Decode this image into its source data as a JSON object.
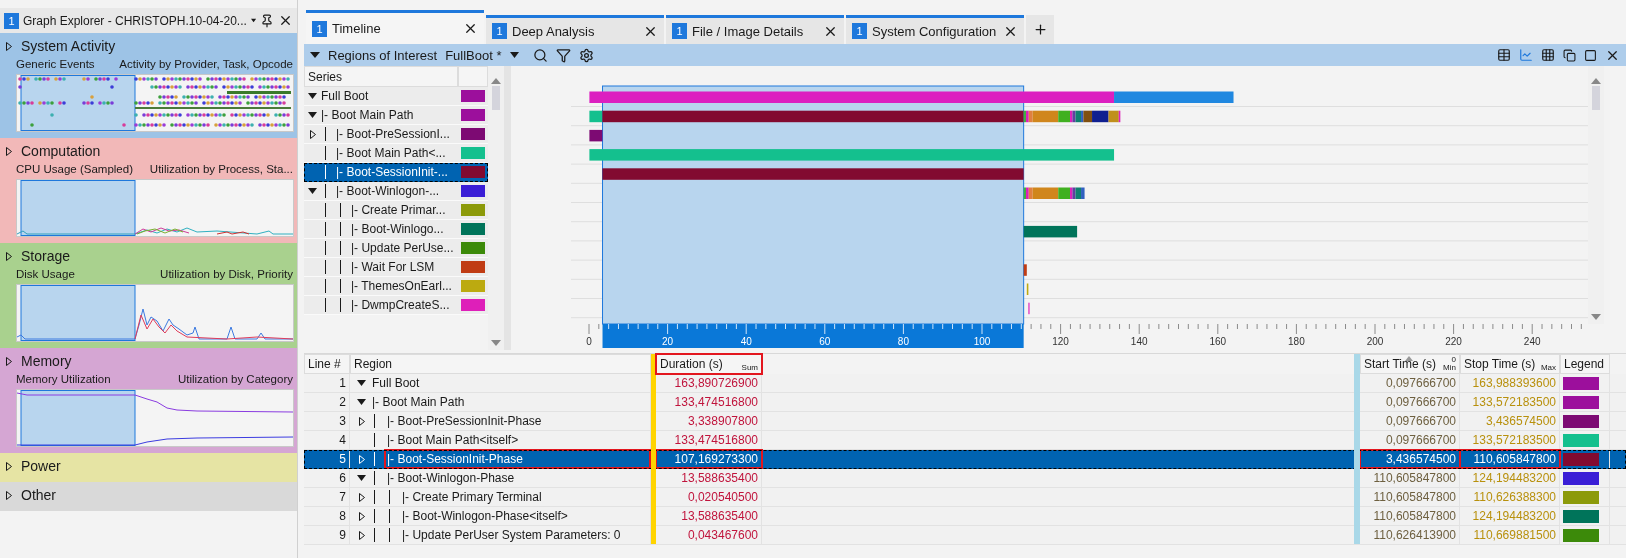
{
  "graph_explorer": {
    "badge": "1",
    "title": "Graph Explorer - CHRISTOPH.10-04-20...",
    "sections": [
      {
        "title": "System Activity",
        "color": "#9dc3e6",
        "expanded": false,
        "graph": {
          "kind": "events",
          "name": "Generic Events",
          "preset": "Activity by Provider, Task, Opcode"
        }
      },
      {
        "title": "Computation",
        "color": "#f2b8b8",
        "expanded": false,
        "graph": {
          "kind": "cpu",
          "name": "CPU Usage (Sampled)",
          "preset": "Utilization by Process, Sta..."
        }
      },
      {
        "title": "Storage",
        "color": "#a9d18e",
        "expanded": false,
        "graph": {
          "kind": "disk",
          "name": "Disk Usage",
          "preset": "Utilization by Disk, Priority"
        }
      },
      {
        "title": "Memory",
        "color": "#d5a6d3",
        "expanded": false,
        "graph": {
          "kind": "memory",
          "name": "Memory Utilization",
          "preset": "Utilization by Category"
        }
      },
      {
        "title": "Power",
        "color": "#e6e4a4",
        "expanded": false
      },
      {
        "title": "Other",
        "color": "#d9d9d9",
        "expanded": false
      }
    ]
  },
  "tabs": [
    {
      "badge": "1",
      "label": "Timeline",
      "selected": true
    },
    {
      "badge": "1",
      "label": "Deep Analysis",
      "selected": false
    },
    {
      "badge": "1",
      "label": "File / Image Details",
      "selected": false
    },
    {
      "badge": "1",
      "label": "System Configuration",
      "selected": false
    }
  ],
  "toolbar": {
    "label": "Regions of Interest",
    "profile": "FullBoot *"
  },
  "series": {
    "header": "Series",
    "rows": [
      {
        "label": "Full Boot",
        "color": "#9c0f9c",
        "expanded": true,
        "selected": false,
        "children": [
          {
            "label": "|- Boot Main Path",
            "color": "#9c0f9c",
            "expanded": true,
            "selected": false,
            "children": [
              {
                "label": "|- Boot-PreSessionI...",
                "color": "#7d0a73",
                "expanded": false,
                "selected": false
              },
              {
                "label": "|- Boot Main Path<...",
                "color": "#14c08e",
                "selected": false
              },
              {
                "label": "|- Boot-SessionInit-...",
                "color": "#820a30",
                "selected": true
              },
              {
                "label": "|- Boot-Winlogon-...",
                "color": "#3a1ed6",
                "expanded": true,
                "selected": false,
                "children": [
                  {
                    "label": "|- Create Primar...",
                    "color": "#8c9a0a",
                    "selected": false
                  },
                  {
                    "label": "|- Boot-Winlogo...",
                    "color": "#00745a",
                    "selected": false
                  },
                  {
                    "label": "|- Update PerUse...",
                    "color": "#3c8a0a",
                    "selected": false
                  },
                  {
                    "label": "|- Wait For LSM",
                    "color": "#c03c14",
                    "selected": false
                  },
                  {
                    "label": "|- ThemesOnEarl...",
                    "color": "#bcaa10",
                    "selected": false
                  },
                  {
                    "label": "|- DwmpCreateS...",
                    "color": "#de1fb9",
                    "selected": false
                  }
                ]
              }
            ]
          }
        ]
      }
    ]
  },
  "timeline": {
    "ticks": [
      "0",
      "20",
      "40",
      "60",
      "80",
      "100",
      "120",
      "140",
      "160",
      "180",
      "200",
      "220",
      "240"
    ]
  },
  "table": {
    "columns": [
      {
        "label": "Line #"
      },
      {
        "label": "Region"
      },
      {
        "label": "Duration (s)",
        "aggregate": "Sum",
        "highlighted": true
      },
      {
        "label": "Start Time (s)",
        "aggregate": "Min",
        "sort_order": "0",
        "highlighted": false
      },
      {
        "label": "Stop Time (s)",
        "aggregate": "Max",
        "highlighted": false
      },
      {
        "label": "Legend"
      }
    ],
    "rows": [
      {
        "line": "1",
        "region": "Full Boot",
        "duration": "163,890726900",
        "start": "0,097666700",
        "stop": "163,988393600",
        "color": "#9c0f9c",
        "expanded": true,
        "selected": false,
        "highlighted": false,
        "children": [
          {
            "line": "2",
            "region": "|- Boot Main Path",
            "duration": "133,474516800",
            "start": "0,097666700",
            "stop": "133,572183500",
            "color": "#9c0f9c",
            "expanded": true,
            "selected": false,
            "highlighted": false,
            "children": [
              {
                "line": "3",
                "region": "|- Boot-PreSessionInit-Phase",
                "duration": "3,338907800",
                "start": "0,097666700",
                "stop": "3,436574500",
                "color": "#7d0a73",
                "expanded": false,
                "selected": false,
                "highlighted": false
              },
              {
                "line": "4",
                "region": "|- Boot Main Path<itself>",
                "duration": "133,474516800",
                "start": "0,097666700",
                "stop": "133,572183500",
                "color": "#14c08e",
                "selected": false,
                "highlighted": false
              },
              {
                "line": "5",
                "region": "|- Boot-SessionInit-Phase",
                "duration": "107,169273300",
                "start": "3,436574500",
                "stop": "110,605847800",
                "color": "#820a30",
                "expanded": false,
                "selected": true,
                "highlighted": true
              },
              {
                "line": "6",
                "region": "|- Boot-Winlogon-Phase",
                "duration": "13,588635400",
                "start": "110,605847800",
                "stop": "124,194483200",
                "color": "#3a1ed6",
                "expanded": true,
                "selected": false,
                "highlighted": false,
                "children": [
                  {
                    "line": "7",
                    "region": "|- Create Primary Terminal",
                    "duration": "0,020540500",
                    "start": "110,605847800",
                    "stop": "110,626388300",
                    "color": "#8c9a0a",
                    "expanded": false,
                    "selected": false,
                    "highlighted": false
                  },
                  {
                    "line": "8",
                    "region": "|- Boot-Winlogon-Phase<itself>",
                    "duration": "13,588635400",
                    "start": "110,605847800",
                    "stop": "124,194483200",
                    "color": "#00745a",
                    "expanded": false,
                    "selected": false,
                    "highlighted": false
                  },
                  {
                    "line": "9",
                    "region": "|- Update PerUser System Parameters: 0",
                    "duration": "0,043467600",
                    "start": "110,626413900",
                    "stop": "110,669881500",
                    "color": "#3c8a0a",
                    "expanded": false,
                    "selected": false,
                    "highlighted": false
                  }
                ]
              }
            ]
          }
        ]
      }
    ]
  }
}
